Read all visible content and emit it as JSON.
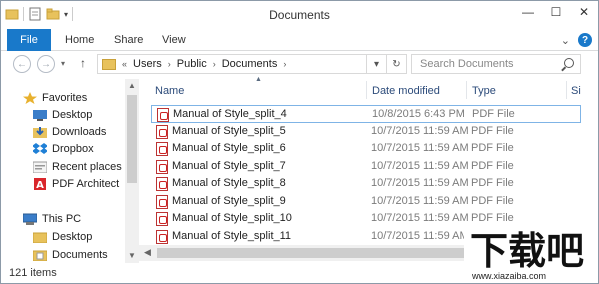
{
  "window": {
    "title": "Documents"
  },
  "ribbon": {
    "tabs": [
      "File",
      "Home",
      "Share",
      "View"
    ]
  },
  "address": {
    "prefix": "«",
    "crumbs": [
      "Users",
      "Public",
      "Documents"
    ]
  },
  "search": {
    "placeholder": "Search Documents"
  },
  "nav": {
    "favorites_label": "Favorites",
    "favorites": [
      "Desktop",
      "Downloads",
      "Dropbox",
      "Recent places",
      "PDF Architect"
    ],
    "thispc_label": "This PC",
    "thispc": [
      "Desktop",
      "Documents"
    ]
  },
  "columns": {
    "name": "Name",
    "date": "Date modified",
    "type": "Type",
    "size": "Si"
  },
  "files": [
    {
      "name": "Manual of Style_split_4",
      "date": "10/8/2015 6:43 PM",
      "type": "PDF File"
    },
    {
      "name": "Manual of Style_split_5",
      "date": "10/7/2015 11:59 AM",
      "type": "PDF File"
    },
    {
      "name": "Manual of Style_split_6",
      "date": "10/7/2015 11:59 AM",
      "type": "PDF File"
    },
    {
      "name": "Manual of Style_split_7",
      "date": "10/7/2015 11:59 AM",
      "type": "PDF File"
    },
    {
      "name": "Manual of Style_split_8",
      "date": "10/7/2015 11:59 AM",
      "type": "PDF File"
    },
    {
      "name": "Manual of Style_split_9",
      "date": "10/7/2015 11:59 AM",
      "type": "PDF File"
    },
    {
      "name": "Manual of Style_split_10",
      "date": "10/7/2015 11:59 AM",
      "type": "PDF File"
    },
    {
      "name": "Manual of Style_split_11",
      "date": "10/7/2015 11:59 AM",
      "type": "PDF File"
    }
  ],
  "status": {
    "items": "121 items"
  },
  "watermark": {
    "logo": "下载吧",
    "url": "www.xiazaiba.com"
  },
  "colors": {
    "accent": "#1979ca",
    "folder": "#e8c25c",
    "pdf": "#c22222"
  }
}
